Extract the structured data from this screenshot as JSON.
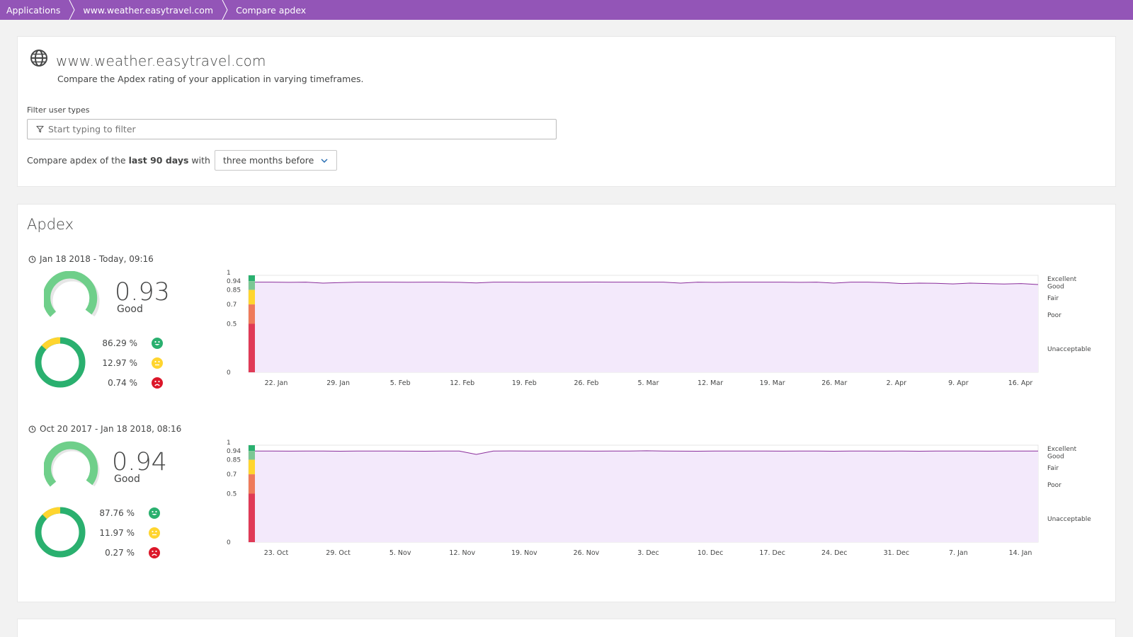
{
  "breadcrumb": [
    "Applications",
    "www.weather.easytravel.com",
    "Compare apdex"
  ],
  "app": {
    "title": "www.weather.easytravel.com",
    "subtitle": "Compare the Apdex rating of your application in varying timeframes."
  },
  "filter": {
    "label": "Filter user types",
    "placeholder": "Start typing to filter"
  },
  "compare": {
    "prefix": "Compare apdex of the",
    "bold": "last 90 days",
    "with": "with",
    "selected": "three months before"
  },
  "apdex": {
    "title": "Apdex",
    "periods": [
      {
        "range": "Jan 18 2018 - Today, 09:16",
        "score": "0.93",
        "rating": "Good",
        "satisfied": "86.29 %",
        "tolerating": "12.97 %",
        "frustrated": "0.74 %"
      },
      {
        "range": "Oct 20 2017 - Jan 18 2018, 08:16",
        "score": "0.94",
        "rating": "Good",
        "satisfied": "87.76 %",
        "tolerating": "11.97 %",
        "frustrated": "0.27 %"
      }
    ]
  },
  "chart_data": [
    {
      "type": "area",
      "y_ticks": [
        "1",
        "0.94",
        "0.85",
        "0.7",
        "0.5",
        "0"
      ],
      "bands": [
        "Excellent",
        "Good",
        "Fair",
        "Poor",
        "Unacceptable"
      ],
      "x_ticks": [
        "22. Jan",
        "29. Jan",
        "5. Feb",
        "12. Feb",
        "19. Feb",
        "26. Feb",
        "5. Mar",
        "12. Mar",
        "19. Mar",
        "26. Mar",
        "2. Apr",
        "9. Apr",
        "16. Apr"
      ],
      "ylim": [
        0,
        1
      ],
      "values": [
        0.93,
        0.93,
        0.928,
        0.93,
        0.92,
        0.925,
        0.93,
        0.93,
        0.93,
        0.929,
        0.93,
        0.93,
        0.928,
        0.922,
        0.93,
        0.93,
        0.929,
        0.93,
        0.93,
        0.93,
        0.931,
        0.93,
        0.93,
        0.93,
        0.93,
        0.92,
        0.93,
        0.928,
        0.93,
        0.93,
        0.93,
        0.93,
        0.928,
        0.93,
        0.92,
        0.93,
        0.93,
        0.925,
        0.915,
        0.92,
        0.918,
        0.912,
        0.92,
        0.915,
        0.91,
        0.915,
        0.905
      ]
    },
    {
      "type": "area",
      "y_ticks": [
        "1",
        "0.94",
        "0.85",
        "0.7",
        "0.5",
        "0"
      ],
      "bands": [
        "Excellent",
        "Good",
        "Fair",
        "Poor",
        "Unacceptable"
      ],
      "x_ticks": [
        "23. Oct",
        "29. Oct",
        "5. Nov",
        "12. Nov",
        "19. Nov",
        "26. Nov",
        "3. Dec",
        "10. Dec",
        "17. Dec",
        "24. Dec",
        "31. Dec",
        "7. Jan",
        "14. Jan"
      ],
      "ylim": [
        0,
        1
      ],
      "values": [
        0.94,
        0.94,
        0.939,
        0.94,
        0.94,
        0.938,
        0.94,
        0.94,
        0.94,
        0.939,
        0.938,
        0.94,
        0.94,
        0.905,
        0.94,
        0.941,
        0.94,
        0.94,
        0.94,
        0.94,
        0.939,
        0.94,
        0.94,
        0.942,
        0.94,
        0.939,
        0.938,
        0.94,
        0.94,
        0.94,
        0.94,
        0.939,
        0.94,
        0.94,
        0.938,
        0.94,
        0.94,
        0.939,
        0.94,
        0.938,
        0.94,
        0.94,
        0.94,
        0.939,
        0.94,
        0.94,
        0.94
      ]
    }
  ],
  "colors": {
    "brand": "#9355b7",
    "excellent": "#2ab06f",
    "good": "#7dc540",
    "fair": "#ffd52f",
    "poor": "#ef651f",
    "unacceptable": "#dc172a",
    "series_line": "#8a2e9b",
    "series_fill": "#f3e9fb"
  }
}
